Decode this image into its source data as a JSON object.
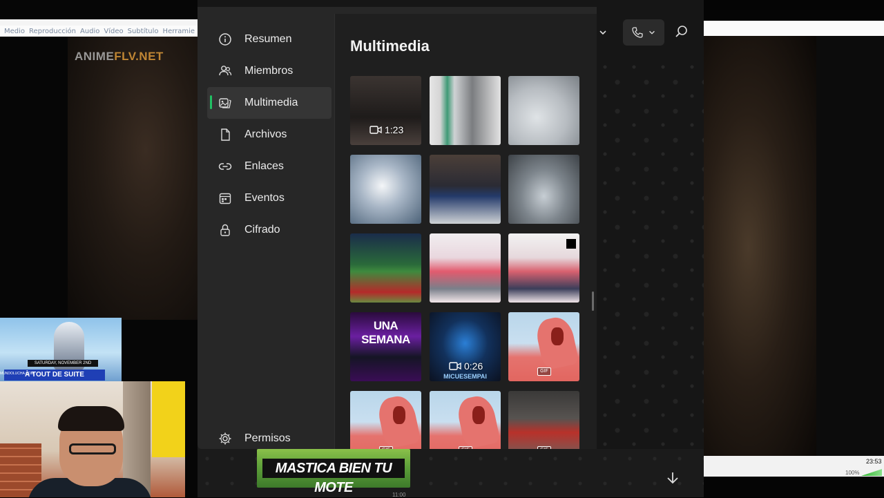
{
  "vlc": {
    "menu": [
      "Medio",
      "Reproducción",
      "Audio",
      "Vídeo",
      "Subtítulo",
      "Herramie"
    ],
    "watermark_main": "ANIME",
    "watermark_accent": "FLV.NET"
  },
  "stream": {
    "top_caption_small": "SATURDAY, NOVEMBER 2ND",
    "top_caption_main": "À TOUT DE SUITE",
    "top_caption_brand": "MUNDOLUCHA.COM"
  },
  "sidebar": {
    "items": [
      {
        "label": "Resumen",
        "icon": "info-icon"
      },
      {
        "label": "Miembros",
        "icon": "members-icon"
      },
      {
        "label": "Multimedia",
        "icon": "media-icon",
        "active": true
      },
      {
        "label": "Archivos",
        "icon": "file-icon"
      },
      {
        "label": "Enlaces",
        "icon": "link-icon"
      },
      {
        "label": "Eventos",
        "icon": "calendar-icon"
      },
      {
        "label": "Cifrado",
        "icon": "lock-icon"
      }
    ],
    "bottom_item": {
      "label": "Permisos",
      "icon": "gear-icon"
    }
  },
  "content": {
    "title": "Multimedia",
    "media": [
      {
        "type": "video",
        "duration": "1:23"
      },
      {
        "type": "image"
      },
      {
        "type": "image"
      },
      {
        "type": "image"
      },
      {
        "type": "image"
      },
      {
        "type": "image"
      },
      {
        "type": "image"
      },
      {
        "type": "image"
      },
      {
        "type": "image"
      },
      {
        "type": "image",
        "overlay_text": "UNA SEMANA"
      },
      {
        "type": "video",
        "duration": "0:26",
        "overlay_text": "MICUESEMPAI"
      },
      {
        "type": "gif",
        "badge": "GIF"
      },
      {
        "type": "gif",
        "badge": "GIF"
      },
      {
        "type": "gif",
        "badge": "GIF"
      },
      {
        "type": "gif",
        "badge": "GIF"
      }
    ]
  },
  "chat": {
    "sticker_text": "MASTICA BIEN TU MOTE",
    "sticker_time": "11:00"
  },
  "taskbar": {
    "clock": "23:53",
    "zoom": "100%"
  },
  "colors": {
    "accent": "#21c063",
    "panel": "#272727",
    "content": "#1f1f1f"
  }
}
